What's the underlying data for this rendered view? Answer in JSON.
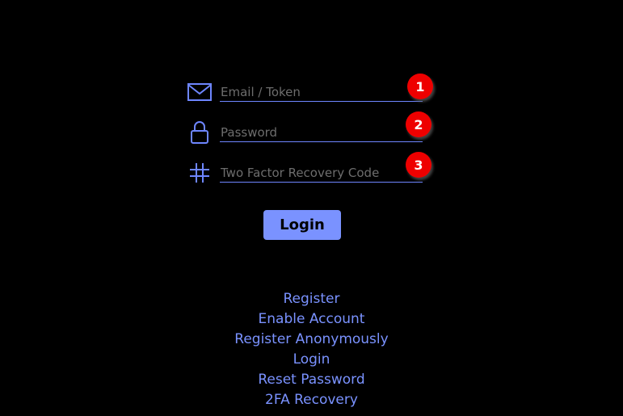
{
  "form": {
    "email": {
      "placeholder": "Email / Token",
      "value": "",
      "icon": "envelope-icon"
    },
    "password": {
      "placeholder": "Password",
      "value": "",
      "icon": "lock-icon"
    },
    "recovery": {
      "placeholder": "Two Factor Recovery Code",
      "value": "",
      "icon": "hash-icon"
    },
    "login_label": "Login"
  },
  "badges": [
    "1",
    "2",
    "3"
  ],
  "links": {
    "register": "Register",
    "enable_account": "Enable Account",
    "register_anonymously": "Register Anonymously",
    "login": "Login",
    "reset_password": "Reset Password",
    "twofa_recovery": "2FA Recovery"
  },
  "colors": {
    "background": "#000000",
    "accent": "#7a92ff",
    "underline": "#6e86ff",
    "badge": "#ee0000",
    "placeholder": "#6d6d6d"
  }
}
